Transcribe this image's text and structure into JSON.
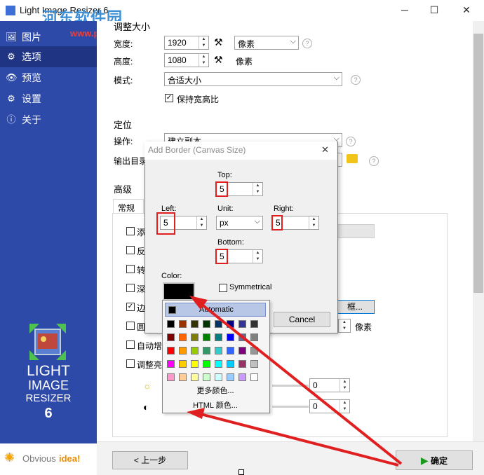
{
  "window": {
    "title": "Light Image Resizer 6",
    "watermark_site": "河东软件园",
    "watermark_url": "www.pc0359.cn",
    "minimize": "─",
    "maximize": "☐",
    "close": "✕"
  },
  "sidebar": {
    "items": [
      {
        "icon": "🖼",
        "label": "图片"
      },
      {
        "icon": "⚙",
        "label": "选项"
      },
      {
        "icon": "👁",
        "label": "预览"
      },
      {
        "icon": "⚙",
        "label": "设置"
      },
      {
        "icon": "ⓘ",
        "label": "关于"
      }
    ],
    "brand_line1": "LIGHT",
    "brand_line2": "IMAGE",
    "brand_line3": "RESIZER",
    "brand_line4": "6",
    "company_prefix": "Obvious",
    "company_suffix": "idea!"
  },
  "main": {
    "resize_title": "调整大小",
    "width_label": "宽度:",
    "width_value": "1920",
    "height_label": "高度:",
    "height_value": "1080",
    "unit_value": "像素",
    "unit_text": "像素",
    "mode_label": "模式:",
    "mode_value": "合适大小",
    "keep_ratio": "保持宽高比",
    "position_title": "定位",
    "action_label": "操作:",
    "action_value": "建立副本",
    "output_label": "输出目录",
    "advanced_title": "高级",
    "tab_general": "常规",
    "adv_items": [
      "添",
      "反",
      "转",
      "深",
      "边",
      "圆",
      "自动增",
      "调整亮"
    ],
    "border_button": "框...",
    "side_unit": "像素",
    "brightness_value": "0",
    "contrast_value": "0",
    "back_button": "< 上一步",
    "ok_button": "确定"
  },
  "dialog": {
    "title": "Add Border (Canvas Size)",
    "top_label": "Top:",
    "top_value": "5",
    "left_label": "Left:",
    "left_value": "5",
    "unit_label": "Unit:",
    "unit_value": "px",
    "right_label": "Right:",
    "right_value": "5",
    "bottom_label": "Bottom:",
    "bottom_value": "5",
    "color_label": "Color:",
    "symmetrical": "Symmetrical",
    "cancel": "Cancel",
    "close": "✕"
  },
  "color_popup": {
    "automatic": "Automatic",
    "more_colors": "更多颜色...",
    "html_colors": "HTML 颜色...",
    "colors": [
      "#993300",
      "#333300",
      "#003300",
      "#003366",
      "#000080",
      "#333399",
      "#333333",
      "#800000",
      "#FF6600",
      "#808000",
      "#008000",
      "#008080",
      "#0000FF",
      "#666699",
      "#808080",
      "#FF0000",
      "#FF9900",
      "#99CC00",
      "#339966",
      "#33CCCC",
      "#3366FF",
      "#800080",
      "#969696",
      "#FF00FF",
      "#FFCC00",
      "#FFFF00",
      "#00FF00",
      "#00FFFF",
      "#00CCFF",
      "#993366",
      "#C0C0C0",
      "#FF99CC",
      "#FFCC99",
      "#FFFF99",
      "#CCFFCC",
      "#CCFFFF",
      "#99CCFF",
      "#CC99FF",
      "#FFFFFF"
    ],
    "first_row_colors": [
      "#000000"
    ]
  },
  "colors": {
    "sidebar": "#2e4aa8",
    "highlight": "#e02020",
    "ok_green": "#1a9a1a"
  }
}
